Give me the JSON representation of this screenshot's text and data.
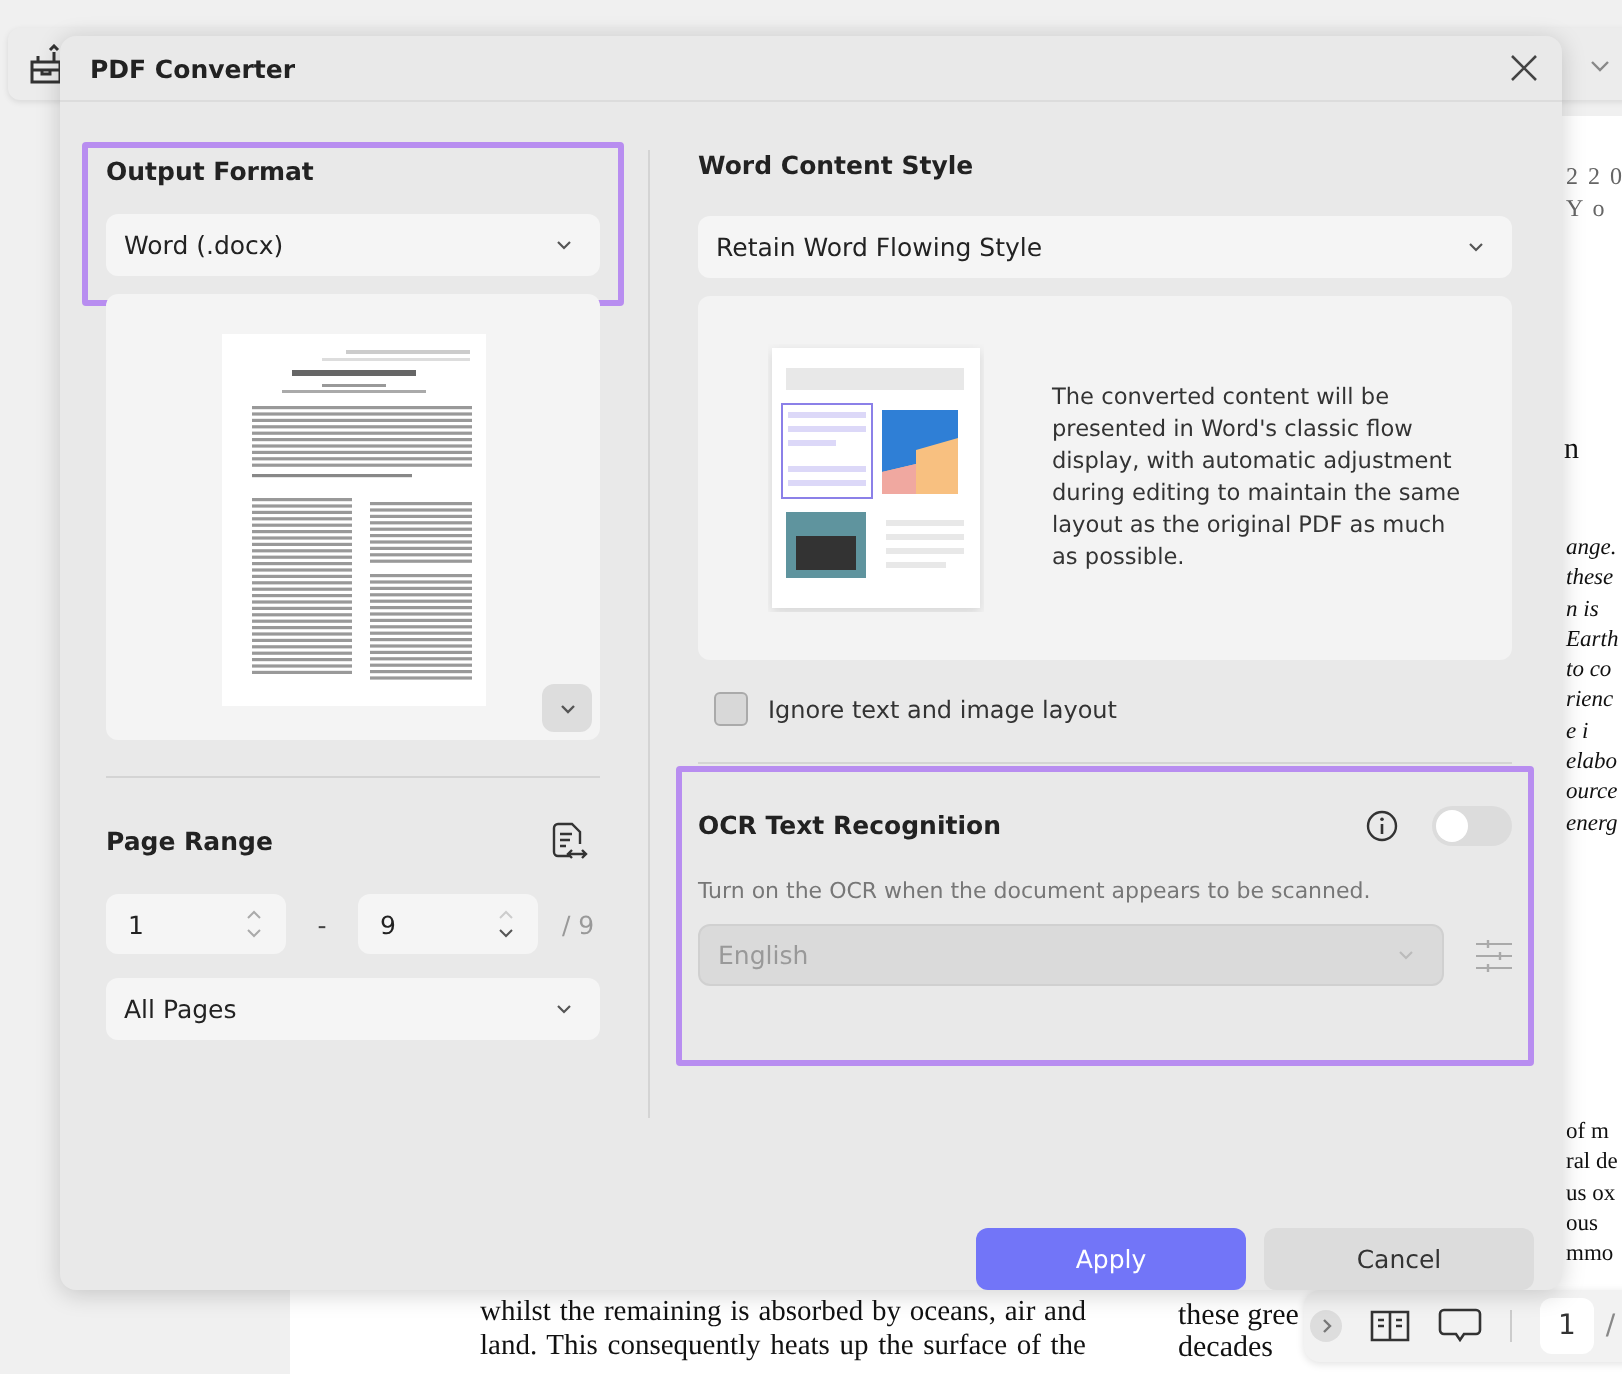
{
  "background_document": {
    "header_fragments": [
      "2 2 0",
      "Y o"
    ],
    "side_fragment": "n",
    "right_fragments_upper": [
      "ange.",
      "these",
      "n is",
      "Earth",
      "to co",
      "rienc",
      "e i",
      "elabo",
      "ource",
      "energ"
    ],
    "right_fragments_lower": [
      "of m",
      "ral de",
      "us ox",
      "ous",
      "mmo"
    ],
    "bottom_left_lines": [
      "whilst the remaining is absorbed by oceans, air and",
      "land. This consequently heats up the surface of the"
    ],
    "bottom_right_lines": [
      "these gree",
      "decades"
    ]
  },
  "page_toolbar": {
    "page": "1",
    "total": "/"
  },
  "dialog": {
    "title": "PDF Converter",
    "output_format": {
      "label": "Output Format",
      "value": "Word (.docx)",
      "highlighted": true
    },
    "page_range": {
      "label": "Page Range",
      "from": "1",
      "separator": "-",
      "to": "9",
      "total": "/ 9",
      "scope": "All Pages"
    },
    "word_content_style": {
      "label": "Word Content Style",
      "value": "Retain Word Flowing Style",
      "description": "The converted content will be presented in Word's classic flow display, with automatic adjustment during editing to maintain the same layout as the original PDF as much as possible.",
      "checkbox": {
        "label": "Ignore text and image layout",
        "checked": false
      }
    },
    "ocr": {
      "label": "OCR Text Recognition",
      "on": false,
      "hint": "Turn on the OCR when the document appears to be scanned.",
      "language": "English",
      "disabled": true,
      "highlighted": true
    },
    "buttons": [
      {
        "label": "Apply",
        "kind": "primary"
      },
      {
        "label": "Cancel",
        "kind": "secondary"
      }
    ]
  }
}
